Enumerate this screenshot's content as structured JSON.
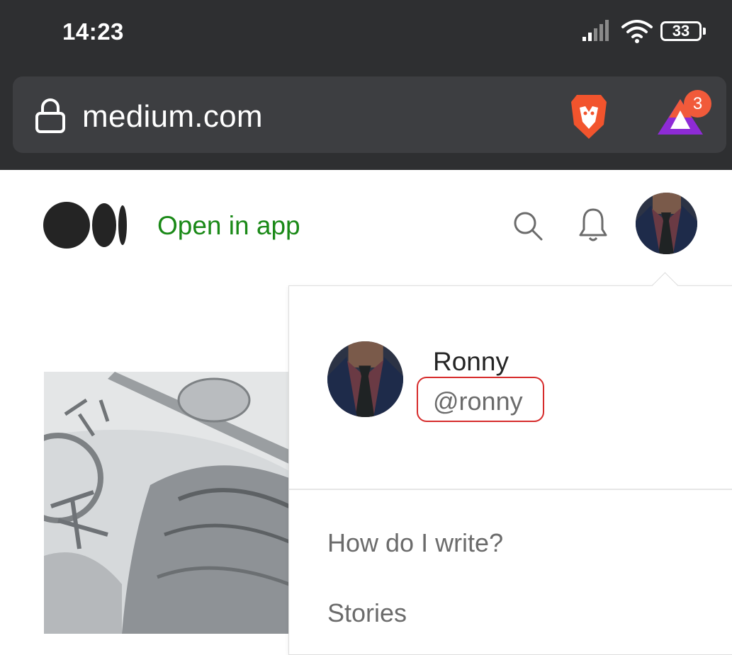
{
  "status_bar": {
    "time": "14:23",
    "battery": "33",
    "icons": [
      "signal-icon",
      "wifi-icon",
      "battery-icon"
    ]
  },
  "browser": {
    "url": "medium.com",
    "rewards_badge_count": "3",
    "icons": [
      "lock-icon",
      "brave-shields-icon",
      "brave-rewards-icon"
    ]
  },
  "header": {
    "open_in_app": "Open in app",
    "icons": [
      "medium-logo-icon",
      "search-icon",
      "bell-icon"
    ],
    "accent_color": "#1a8917"
  },
  "profile_menu": {
    "name": "Ronny",
    "handle": "@ronny",
    "items": [
      {
        "label": "How do I write?"
      },
      {
        "label": "Stories"
      }
    ]
  },
  "colors": {
    "chrome_background": "#2e2f31",
    "url_bar_background": "#3d3e41",
    "highlight_border": "#d62b2b"
  }
}
